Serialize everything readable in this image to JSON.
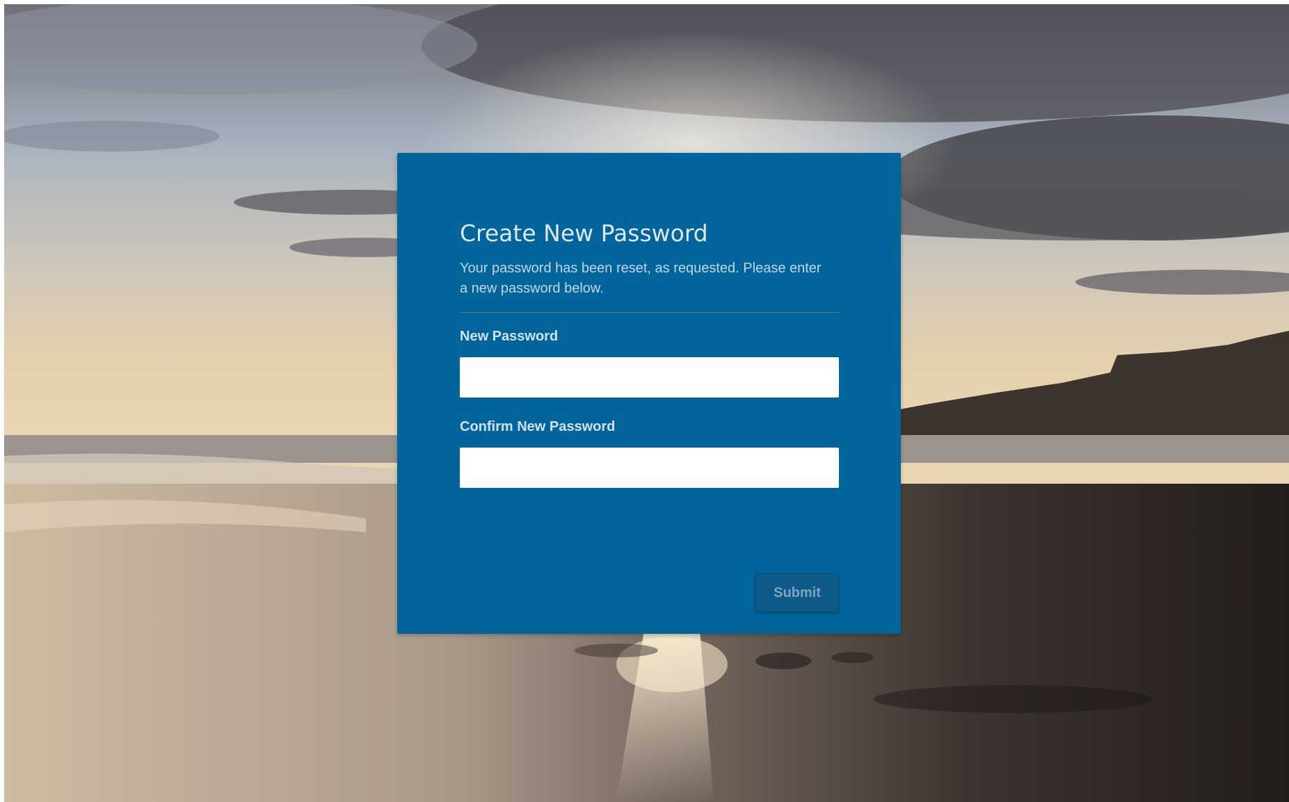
{
  "form": {
    "title": "Create New Password",
    "description": "Your password has been reset, as requested. Please enter a new password below.",
    "new_password_label": "New Password",
    "new_password_value": "",
    "confirm_password_label": "Confirm New Password",
    "confirm_password_value": "",
    "submit_label": "Submit"
  },
  "colors": {
    "card_background": "#01659b",
    "button_background": "#0e5a88",
    "field_background": "#ffffff"
  }
}
